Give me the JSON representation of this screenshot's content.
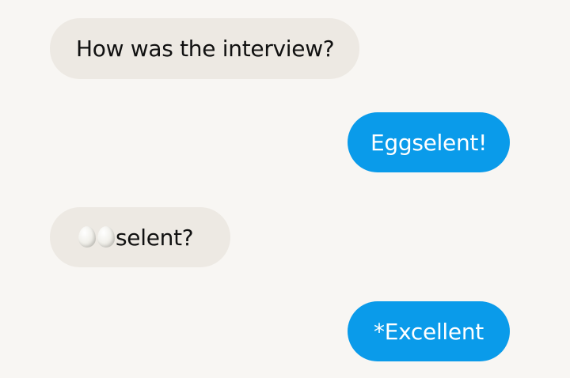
{
  "messages": [
    {
      "direction": "incoming",
      "text": "How was the interview?"
    },
    {
      "direction": "outgoing",
      "text": "Eggselent!"
    },
    {
      "direction": "incoming",
      "emoji": [
        "egg",
        "egg"
      ],
      "text": "selent?"
    },
    {
      "direction": "outgoing",
      "text": "*Excellent"
    }
  ],
  "colors": {
    "background": "#f8f6f3",
    "incoming_bubble": "#ede9e3",
    "outgoing_bubble": "#0a9bea",
    "incoming_text": "#111111",
    "outgoing_text": "#ffffff"
  }
}
